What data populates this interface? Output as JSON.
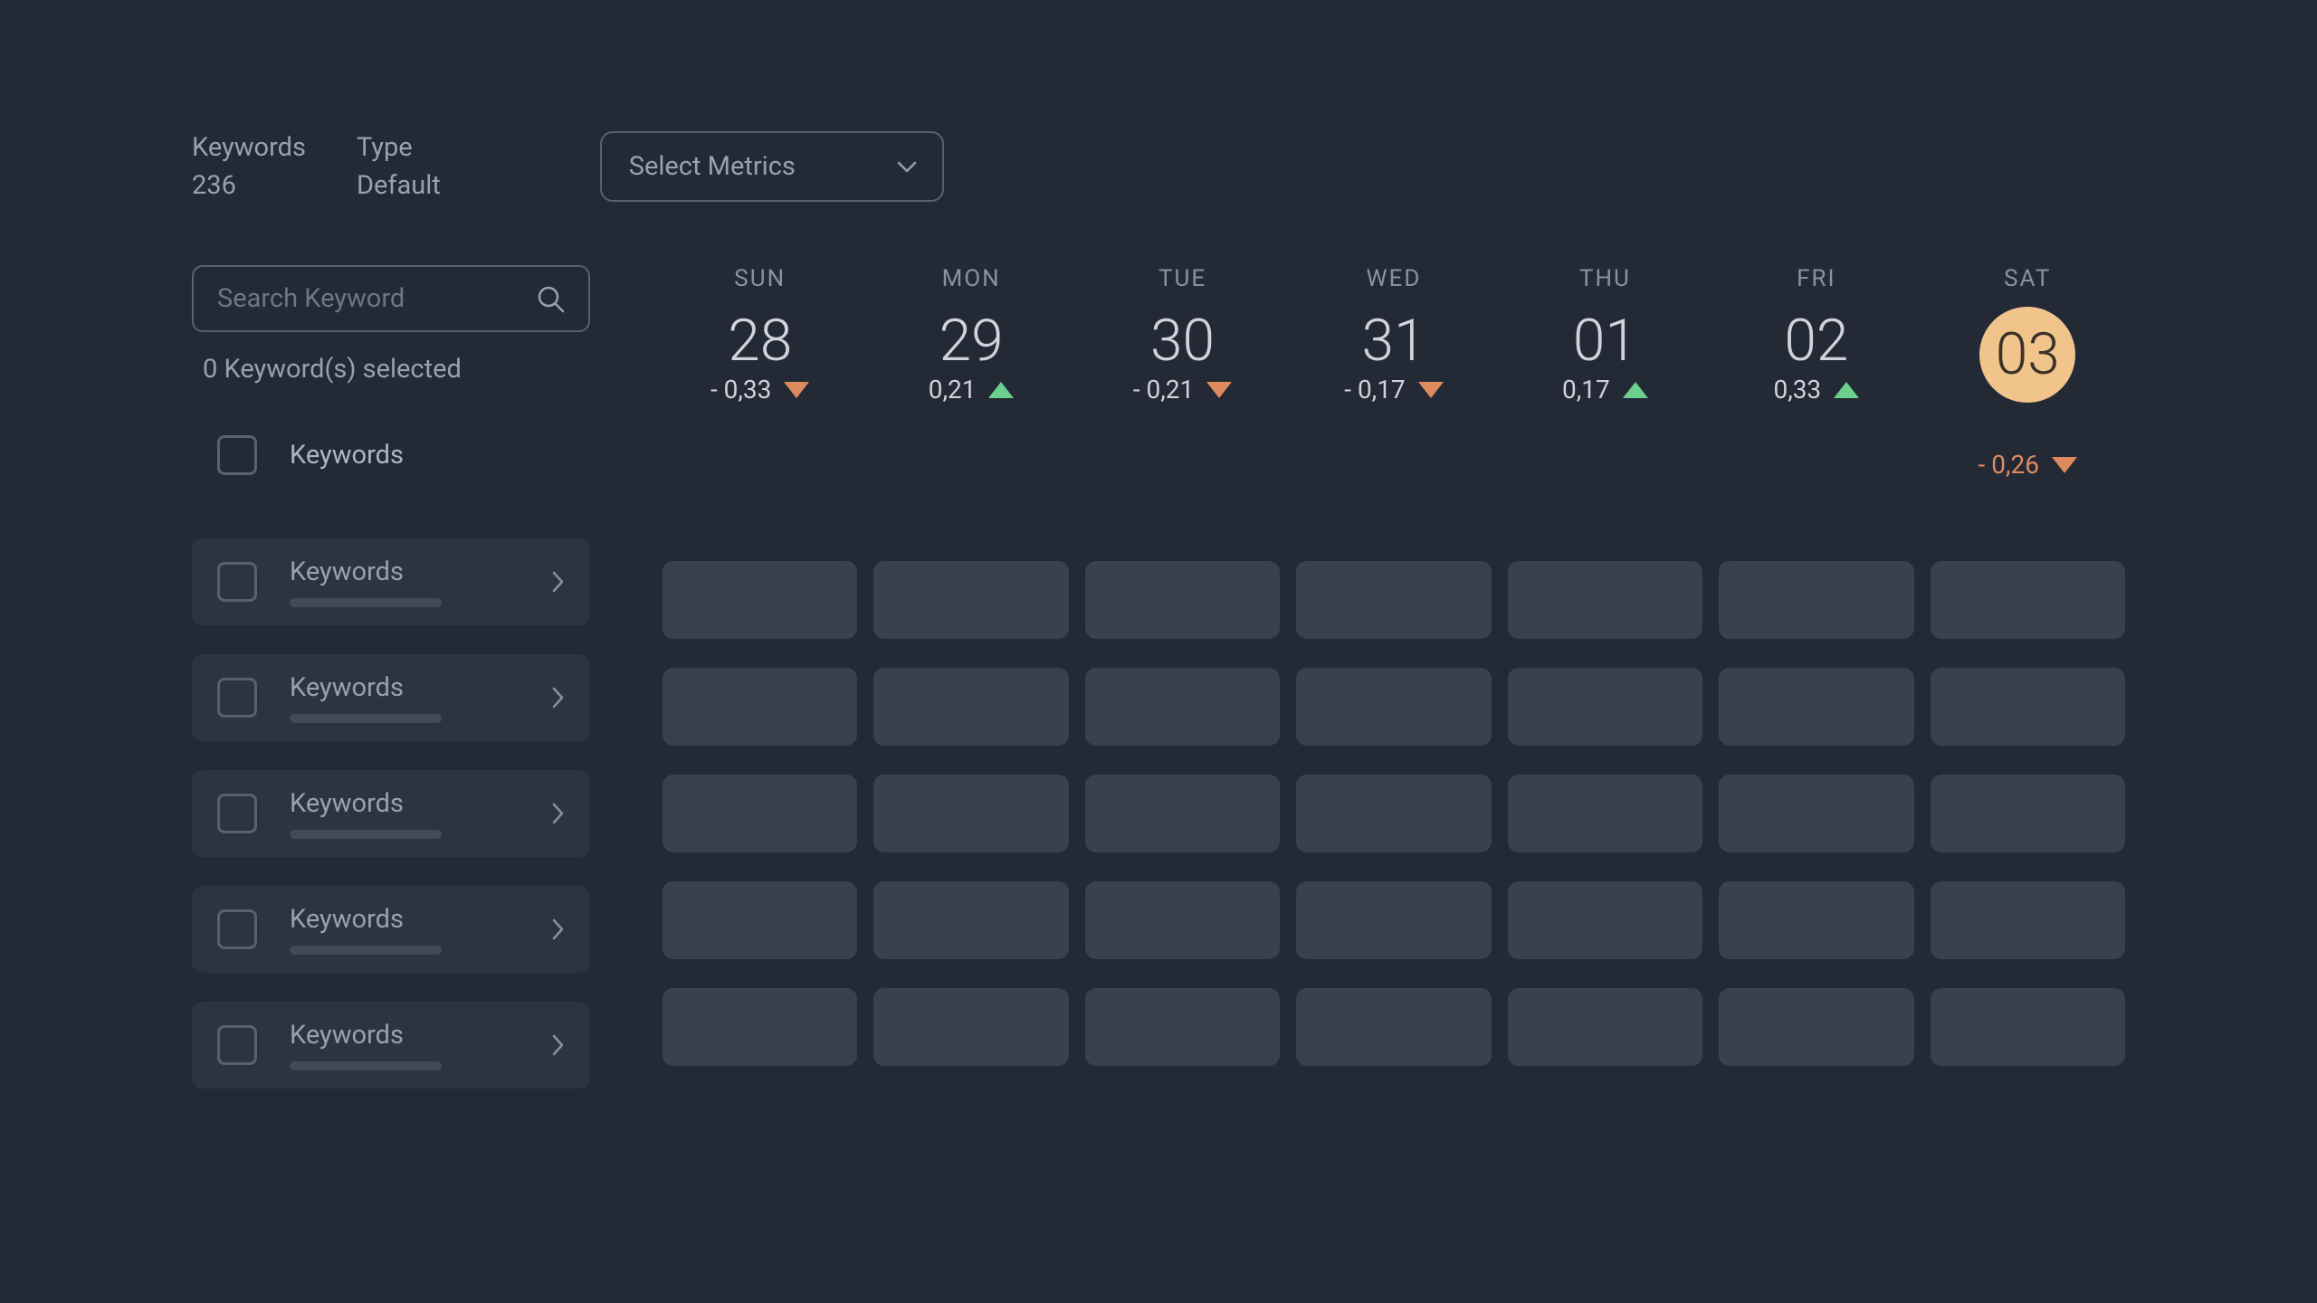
{
  "header": {
    "keywords_label": "Keywords",
    "keywords_value": "236",
    "type_label": "Type",
    "type_value": "Default",
    "select_metrics_label": "Select Metrics"
  },
  "sidebar": {
    "search_placeholder": "Search Keyword",
    "selected_count": "0 Keyword(s) selected",
    "header_label": "Keywords",
    "rows": [
      {
        "label": "Keywords"
      },
      {
        "label": "Keywords"
      },
      {
        "label": "Keywords"
      },
      {
        "label": "Keywords"
      },
      {
        "label": "Keywords"
      }
    ]
  },
  "days": [
    {
      "name": "SUN",
      "num": "28",
      "val": "- 0,33",
      "dir": "down",
      "highlight": false
    },
    {
      "name": "MON",
      "num": "29",
      "val": "0,21",
      "dir": "up",
      "highlight": false
    },
    {
      "name": "TUE",
      "num": "30",
      "val": "- 0,21",
      "dir": "down",
      "highlight": false
    },
    {
      "name": "WED",
      "num": "31",
      "val": "- 0,17",
      "dir": "down",
      "highlight": false
    },
    {
      "name": "THU",
      "num": "01",
      "val": "0,17",
      "dir": "up",
      "highlight": false
    },
    {
      "name": "FRI",
      "num": "02",
      "val": "0,33",
      "dir": "up",
      "highlight": false
    },
    {
      "name": "SAT",
      "num": "03",
      "val": "- 0,26",
      "dir": "down",
      "highlight": true
    }
  ],
  "grid": {
    "rows": 5,
    "cols": 7
  }
}
